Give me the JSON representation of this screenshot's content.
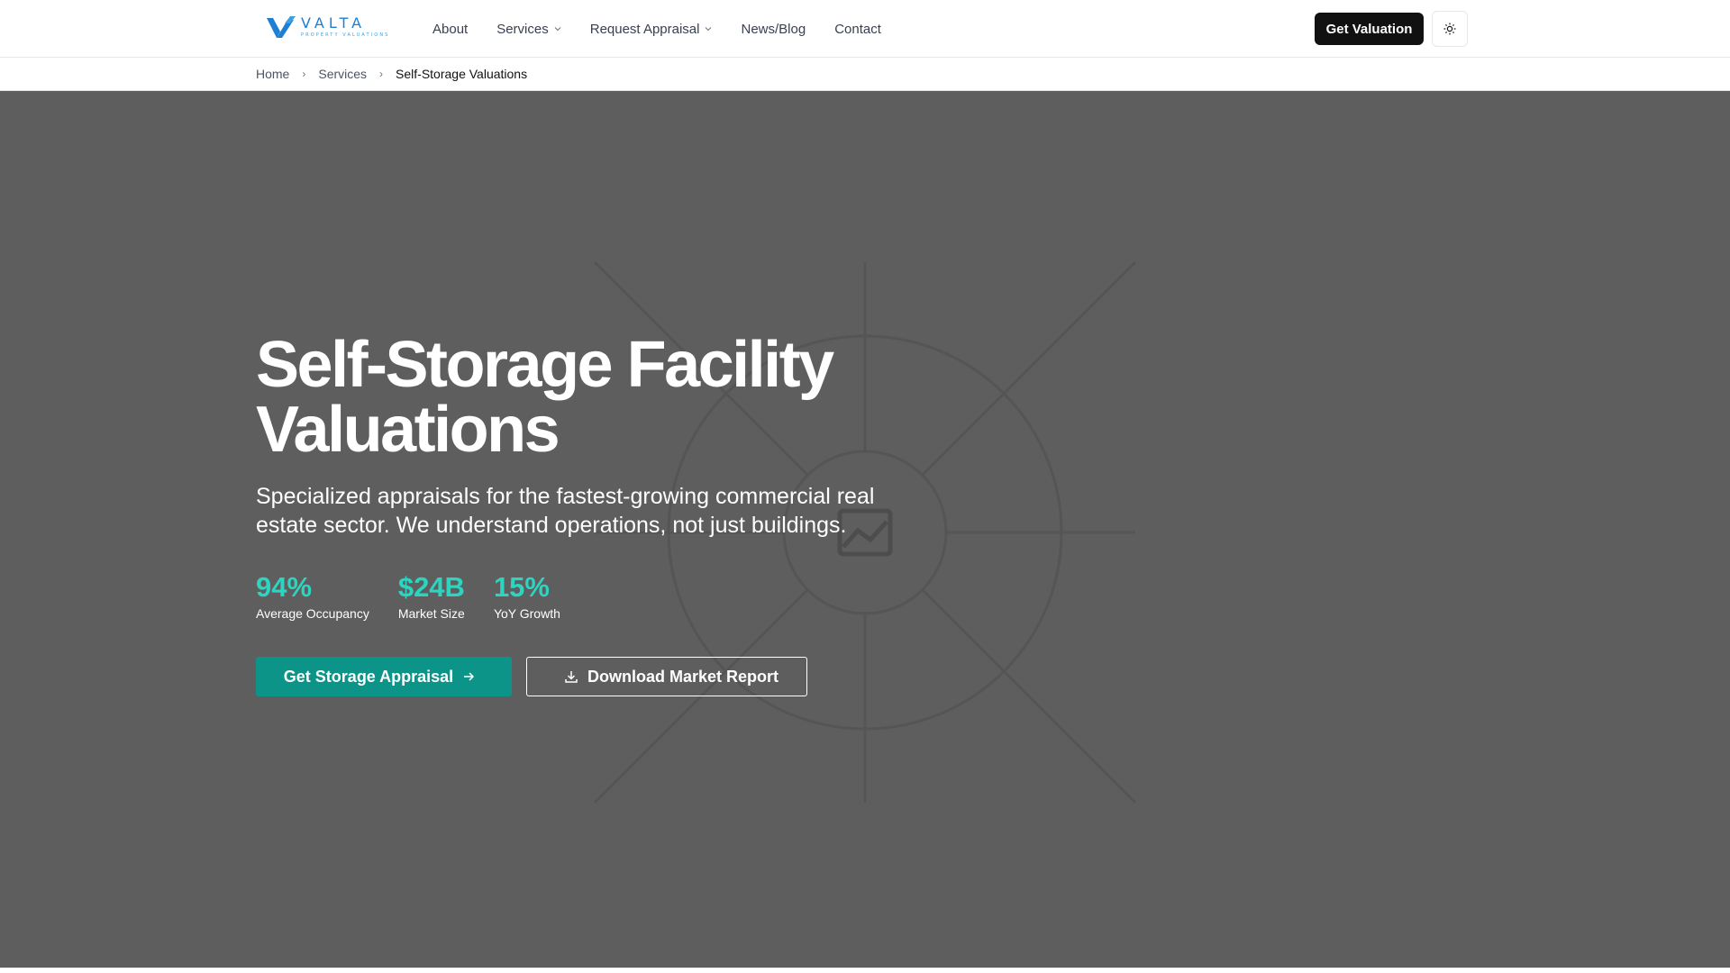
{
  "brand": {
    "name": "VALTA",
    "tagline": "PROPERTY VALUATIONS"
  },
  "nav": {
    "items": [
      {
        "label": "About"
      },
      {
        "label": "Services"
      },
      {
        "label": "Request Appraisal"
      },
      {
        "label": "News/Blog"
      },
      {
        "label": "Contact"
      }
    ],
    "cta_label": "Get Valuation"
  },
  "breadcrumb": {
    "items": [
      "Home",
      "Services",
      "Self-Storage Valuations"
    ]
  },
  "hero": {
    "title_line1": "Self-Storage Facility",
    "title_line2": "Valuations",
    "subtitle": "Specialized appraisals for the fastest-growing commercial real estate sector. We understand operations, not just buildings.",
    "stats": [
      {
        "value": "94%",
        "label": "Average Occupancy"
      },
      {
        "value": "$24B",
        "label": "Market Size"
      },
      {
        "value": "15%",
        "label": "YoY Growth"
      }
    ],
    "primary_label": "Get Storage Appraisal",
    "secondary_label": "Download Market Report"
  },
  "colors": {
    "brand_blue": "#1d7fd4",
    "accent_teal": "#0d9488",
    "stat_teal": "#2dd4bf",
    "hero_bg": "#5e5e5e",
    "cta_dark": "#111111"
  }
}
